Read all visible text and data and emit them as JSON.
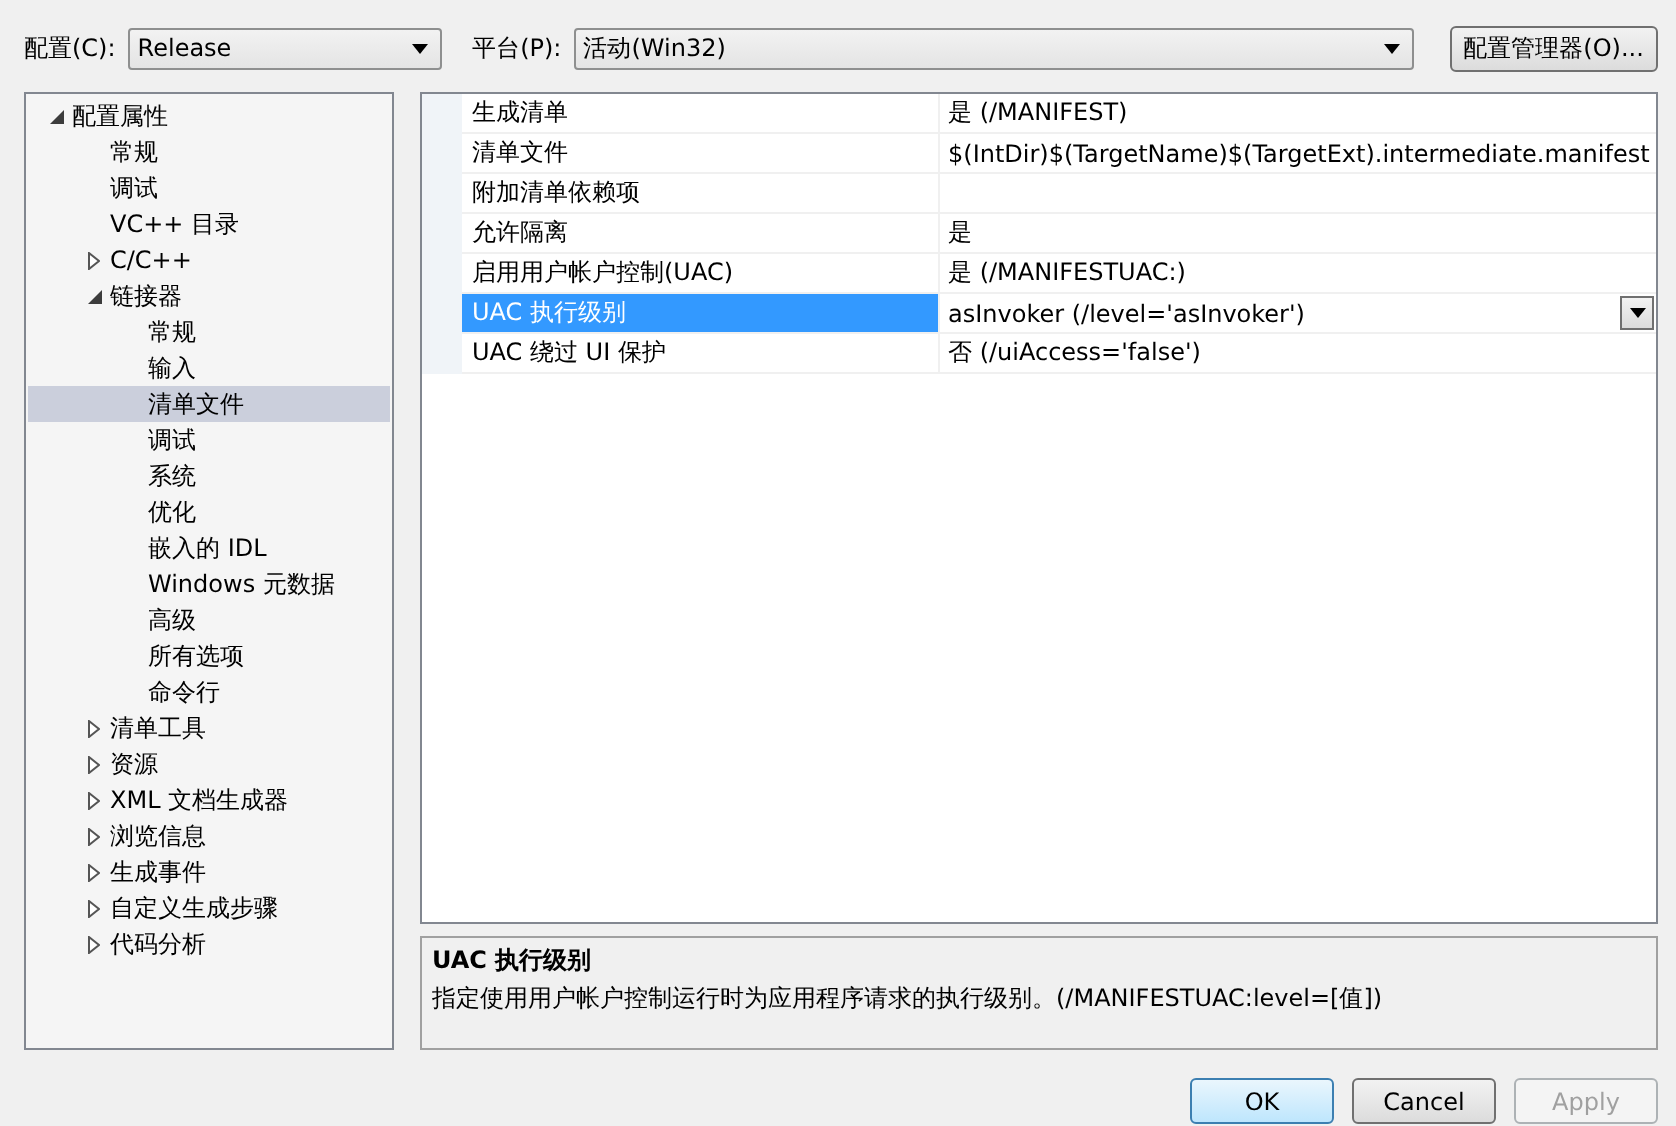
{
  "config": {
    "label": "配置(C):",
    "value": "Release"
  },
  "platform": {
    "label": "平台(P):",
    "value": "活动(Win32)"
  },
  "config_manager_button": "配置管理器(O)...",
  "tree": [
    {
      "label": "配置属性",
      "expanded": true,
      "selected": false,
      "children": [
        {
          "label": "常规",
          "selected": false
        },
        {
          "label": "调试",
          "selected": false
        },
        {
          "label": "VC++ 目录",
          "selected": false
        },
        {
          "label": "C/C++",
          "expanded": false,
          "selected": false
        },
        {
          "label": "链接器",
          "expanded": true,
          "selected": false,
          "children": [
            {
              "label": "常规",
              "selected": false
            },
            {
              "label": "输入",
              "selected": false
            },
            {
              "label": "清单文件",
              "selected": true
            },
            {
              "label": "调试",
              "selected": false
            },
            {
              "label": "系统",
              "selected": false
            },
            {
              "label": "优化",
              "selected": false
            },
            {
              "label": "嵌入的 IDL",
              "selected": false
            },
            {
              "label": "Windows 元数据",
              "selected": false
            },
            {
              "label": "高级",
              "selected": false
            },
            {
              "label": "所有选项",
              "selected": false
            },
            {
              "label": "命令行",
              "selected": false
            }
          ]
        },
        {
          "label": "清单工具",
          "expanded": false,
          "selected": false
        },
        {
          "label": "资源",
          "expanded": false,
          "selected": false
        },
        {
          "label": "XML 文档生成器",
          "expanded": false,
          "selected": false
        },
        {
          "label": "浏览信息",
          "expanded": false,
          "selected": false
        },
        {
          "label": "生成事件",
          "expanded": false,
          "selected": false
        },
        {
          "label": "自定义生成步骤",
          "expanded": false,
          "selected": false
        },
        {
          "label": "代码分析",
          "expanded": false,
          "selected": false
        }
      ]
    }
  ],
  "properties": [
    {
      "name": "生成清单",
      "value": "是 (/MANIFEST)",
      "selected": false
    },
    {
      "name": "清单文件",
      "value": "$(IntDir)$(TargetName)$(TargetExt).intermediate.manifest",
      "selected": false
    },
    {
      "name": "附加清单依赖项",
      "selected": false
    },
    {
      "name": "允许隔离",
      "value": "是",
      "selected": false
    },
    {
      "name": "启用用户帐户控制(UAC)",
      "value": "是 (/MANIFESTUAC:)",
      "selected": false
    },
    {
      "name": "UAC 执行级别",
      "value": "asInvoker (/level='asInvoker')",
      "selected": true
    },
    {
      "name": "UAC 绕过 UI 保护",
      "value": "否 (/uiAccess='false')",
      "selected": false
    }
  ],
  "description": {
    "title": "UAC 执行级别",
    "text": "指定使用用户帐户控制运行时为应用程序请求的执行级别。(/MANIFESTUAC:level=[值])"
  },
  "buttons": [
    {
      "label": "OK",
      "default": true,
      "disabled": false
    },
    {
      "label": "Cancel",
      "default": false,
      "disabled": false
    },
    {
      "label": "Apply",
      "default": false,
      "disabled": true
    }
  ]
}
